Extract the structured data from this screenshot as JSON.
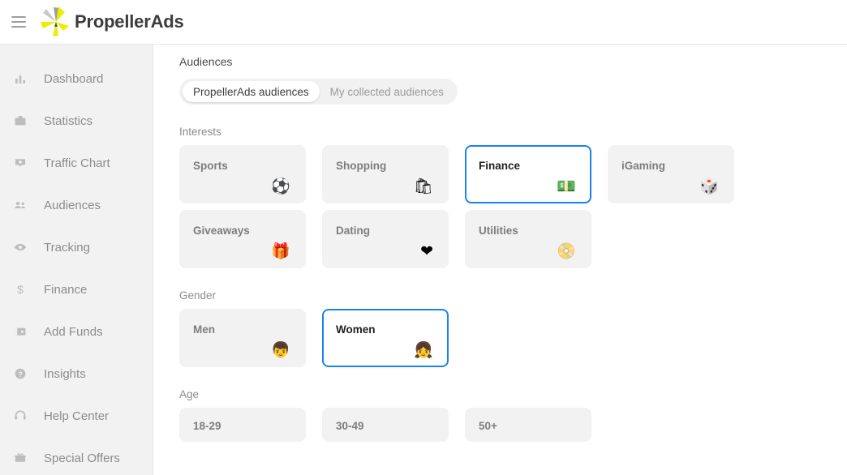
{
  "topbar": {
    "menu_icon": "hamburger-icon",
    "logo_icon": "propeller-logo-icon",
    "brand": "PropellerAds"
  },
  "sidebar": {
    "items": [
      {
        "label": "Dashboard",
        "icon": "bar-chart-icon"
      },
      {
        "label": "Statistics",
        "icon": "briefcase-icon"
      },
      {
        "label": "Traffic Chart",
        "icon": "traffic-chart-icon"
      },
      {
        "label": "Audiences",
        "icon": "people-icon"
      },
      {
        "label": "Tracking",
        "icon": "eye-icon"
      },
      {
        "label": "Finance",
        "icon": "dollar-icon"
      },
      {
        "label": "Add Funds",
        "icon": "wallet-icon"
      },
      {
        "label": "Insights",
        "icon": "question-circle-icon"
      },
      {
        "label": "Help Center",
        "icon": "headset-icon"
      },
      {
        "label": "Special Offers",
        "icon": "gift-box-icon"
      }
    ]
  },
  "main": {
    "title": "Audiences",
    "tabs": [
      {
        "label": "PropellerAds audiences",
        "active": true
      },
      {
        "label": "My collected audiences",
        "active": false
      }
    ],
    "sections": [
      {
        "label": "Interests",
        "rows": [
          [
            {
              "label": "Sports",
              "emoji": "⚽",
              "icon": "soccer-ball-icon",
              "selected": false
            },
            {
              "label": "Shopping",
              "emoji": "🛍",
              "icon": "shopping-bags-icon",
              "selected": false
            },
            {
              "label": "Finance",
              "emoji": "💵",
              "icon": "banknote-icon",
              "selected": true
            },
            {
              "label": "iGaming",
              "emoji": "🎲",
              "icon": "dice-icon",
              "selected": false
            }
          ],
          [
            {
              "label": "Giveaways",
              "emoji": "🎁",
              "icon": "gift-icon",
              "selected": false
            },
            {
              "label": "Dating",
              "emoji": "❤",
              "icon": "heart-icon",
              "selected": false
            },
            {
              "label": "Utilities",
              "emoji": "📀",
              "icon": "disc-icon",
              "selected": false
            }
          ]
        ]
      },
      {
        "label": "Gender",
        "rows": [
          [
            {
              "label": "Men",
              "emoji": "👦",
              "icon": "boy-face-icon",
              "selected": false
            },
            {
              "label": "Women",
              "emoji": "👧",
              "icon": "girl-face-icon",
              "selected": true
            }
          ]
        ]
      },
      {
        "label": "Age",
        "rows": [
          [
            {
              "label": "18-29",
              "emoji": "",
              "icon": "",
              "selected": false
            },
            {
              "label": "30-49",
              "emoji": "",
              "icon": "",
              "selected": false
            },
            {
              "label": "50+",
              "emoji": "",
              "icon": "",
              "selected": false
            }
          ]
        ]
      }
    ]
  },
  "colors": {
    "accent_blue": "#1a82f0",
    "sidebar_bg": "#f2f2f2",
    "card_bg": "#f2f2f2",
    "logo_yellow": "#eded00"
  }
}
